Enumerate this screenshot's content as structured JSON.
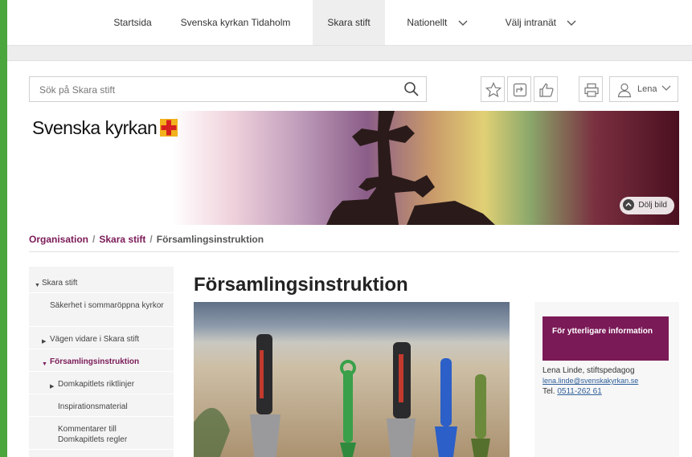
{
  "topnav": {
    "items": [
      {
        "label": "Startsida"
      },
      {
        "label": "Svenska kyrkan Tidaholm"
      },
      {
        "label": "Skara stift"
      },
      {
        "label": "Nationellt"
      },
      {
        "label": "Välj intranät"
      }
    ],
    "active": "Skara stift"
  },
  "search": {
    "placeholder": "Sök på Skara stift",
    "value": ""
  },
  "toolbar": {
    "user_name": "Lena"
  },
  "header": {
    "wordmark": "Svenska kyrkan",
    "hide_image_label": "Dölj bild"
  },
  "breadcrumb": [
    "Organisation",
    "Skara stift",
    "Församlingsinstruktion"
  ],
  "sidenav": {
    "items": [
      {
        "label": "Skara stift",
        "expanded": true
      },
      {
        "label": "Säkerhet i sommaröppna kyrkor"
      },
      {
        "label": "Vägen vidare i Skara stift",
        "expandable": true
      },
      {
        "label": "Församlingsinstruktion",
        "expanded": true,
        "selected": true
      },
      {
        "label": "Domkapitlets riktlinjer",
        "expandable": true
      },
      {
        "label": "Inspirationsmaterial"
      },
      {
        "label": "Kommentarer till Domkapitlets regler"
      }
    ]
  },
  "main": {
    "title": "Församlingsinstruktion"
  },
  "infobox": {
    "heading": "För ytterligare information",
    "name": "Lena Linde, stiftspedagog",
    "email": "lena.linde@svenskakyrkan.se",
    "tel_label": "Tel.",
    "tel": "0511-262 61"
  },
  "colors": {
    "brand": "#7a1a57",
    "frame": "#4aa63d",
    "link": "#2f5f9a"
  }
}
